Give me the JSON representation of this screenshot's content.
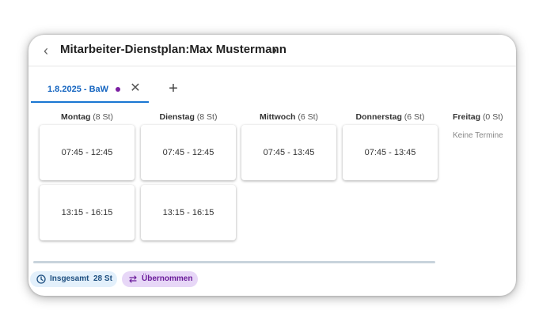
{
  "header": {
    "title": "Mitarbeiter-Dienstplan:Max Mustermann",
    "back_icon": "chevron-left-icon",
    "forward_icon": "chevron-right-icon"
  },
  "tabs": [
    {
      "label": "1.8.2025 - BaW",
      "active": true,
      "dot_color": "#7b1fa2"
    }
  ],
  "add_tab_icon": "plus-icon",
  "days": [
    {
      "name": "Montag",
      "hours": "(8 St)",
      "slots": [
        "07:45 - 12:45",
        "13:15 - 16:15"
      ]
    },
    {
      "name": "Dienstag",
      "hours": "(8 St)",
      "slots": [
        "07:45 - 12:45",
        "13:15 - 16:15"
      ]
    },
    {
      "name": "Mittwoch",
      "hours": "(6 St)",
      "slots": [
        "07:45 - 13:45"
      ]
    },
    {
      "name": "Donnerstag",
      "hours": "(6 St)",
      "slots": [
        "07:45 - 13:45"
      ]
    },
    {
      "name": "Freitag",
      "hours": "(0 St)",
      "slots": [],
      "empty_text": "Keine Termine"
    }
  ],
  "footer": {
    "total_label": "Insgesamt",
    "total_value": "28 St",
    "adopted_label": "Übernommen"
  },
  "colors": {
    "accent": "#1976d2",
    "total_chip_bg": "#e3f0fb",
    "adopted_chip_bg": "#e7d7f7"
  }
}
